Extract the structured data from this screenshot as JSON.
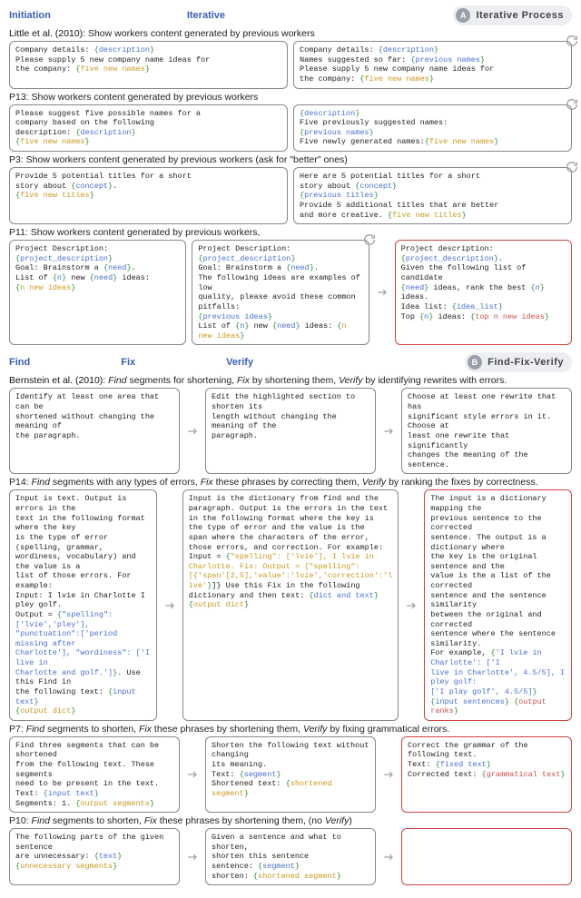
{
  "sectionA": {
    "badge": {
      "letter": "A",
      "label": "Iterative Process"
    },
    "stages": {
      "left": "Initiation",
      "right": "Iterative"
    },
    "source": {
      "cite": "Little et al. (2010): ",
      "desc": "Show workers content generated by previous workers"
    },
    "src_left": "Company details: {description}\nPlease supply 5 new company name ideas for\nthe company: {five new names}",
    "src_right": "Company details: {description}\nNames suggested so far: {previous names}\nPlease supply 5 new company name ideas for\nthe company: {five new names}",
    "p13": {
      "title": "P13: Show workers content generated by previous workers",
      "left": "Please suggest five possible names for a\ncompany based on the following\ndescription: {description}\n{five new names}",
      "right": "{description}\nFive previously suggested names:\n{previous names}\nFive newly generated names:{five new names}"
    },
    "p3": {
      "title": "P3: Show workers content generated by previous workers (ask for \"better\" ones)",
      "left": "Provide 5 potential titles for a short\nstory about {concept}.\n{five new titles}",
      "right": "Here are 5 potential titles for a short\nstory about {concept}\n{previous titles}\nProvide 5 additional titles that are better\nand more creative. {five new titles}"
    },
    "p11": {
      "title": "P11: Show workers content generated by previous workers,",
      "left": "Project Description: {project_description}\nGoal: Brainstorm a {need}.\nList of {n} new {need} ideas:\n{n new ideas}",
      "mid": "Project Description: {project_description}\nGoal: Brainstorm a {need}.\nThe following ideas are examples of low\nquality, please avoid these common pitfalls:\n{previous ideas}\nList of {n} new {need} ideas: {n new ideas}",
      "right": "Project description:{project_description}.\nGiven the following list of candidate\n{need} ideas, rank the best {n} ideas.\nIdea list: {idea_list}\nTop {n} ideas: {top n new ideas}"
    }
  },
  "sectionB": {
    "badge": {
      "letter": "B",
      "label": "Find-Fix-Verify"
    },
    "stages": {
      "a": "Find",
      "b": "Fix",
      "c": "Verify"
    },
    "source": {
      "cite": "Bernstein et al. (2010): ",
      "desc_a": "Find",
      "desc_a2": " segments for shortening, ",
      "desc_b": "Fix",
      "desc_b2": " by shortening them, ",
      "desc_c": "Verify",
      "desc_c2": " by identifying rewrites with errors."
    },
    "src_a": "Identify at least one area that can be\nshortened without changing the meaning of\nthe paragraph.",
    "src_b": "Edit the highlighted section to shorten its\nlength without changing the meaning of the\nparagraph.",
    "src_c": "Choose at least one rewrite that has\nsignificant style errors in it. Choose at\nleast one rewrite that significantly\nchanges the meaning of the sentence.",
    "p14": {
      "title": "P14: Find segments with any types of errors, Fix these phrases by correcting them, Verify by ranking the fixes by correctness.",
      "a": "Input is text. Output is errors in the\ntext in the following format where the key\nis the type of error (spelling, grammar,\nwordiness, vocabulary) and the value is a\nlist of those errors. For example:\nInput: I lvie in Charlotte I pley golf.\nOutput = {\"spelling\":['lvie','pley'],\n\"punctuation\":['period missing after\nCharlotte'], \"wordiness\": ['I live in\nCharlotte and golf.']}. Use this Find in\nthe following text: {input text}\n{output dict}",
      "b": "Input is the dictionary from find and the\nparagraph. Output is the errors in the text\nin the following format where the key is\nthe type of error and the value is the\nspan where the characters of the error,\nthose errors, and correction. For example:\nInput = {\"spelling\": ['lvie'], I lvie in\nCharlotte. Fix: Output = {\"spelling\":\n[{'span'[2,5],'value':'lvie','correction':'l\nive'}]} Use this Fix in the following\ndictionary and then text: {dict and text}\n{output dict}",
      "c": "The input is a dictionary mapping the\nprevious sentence to the corrected\nsentence. The output is a dictionary where\nthe key is the original sentence and the\nvalue is the a list of the corrected\nsentence and the sentence similarity\nbetween the original and corrected\nsentence where the sentence similarity.\nFor example, {'I lvie in Charlotte': ['I\nlive in Charlotte', 4.5/5], I pley golf:\n['I play golf', 4.5/5]}\n{input sentences} {output ranks}"
    },
    "p7": {
      "title": "P7: Find segments to shorten, Fix these phrases by shortening them, Verify by fixing grammatical errors.",
      "a": "Find three segments that can be shortened\nfrom the following text. These segments\nneed to be present in the text.\nText: {input text}\nSegments: 1. {output segments}",
      "b": "Shorten the following text without changing\nits meaning.\nText: {segment}\nShortened text: {shortened segment}",
      "c": "Correct the grammar of the following text.\nText: {fixed text}\nCorrected text: {grammatical text}"
    },
    "p10": {
      "title": "P10: Find segments to shorten, Fix these phrases by shortening them, (no Verify)",
      "a": "The following parts of the given sentence\nare unnecessary: {text}\n{unnecessary segments}",
      "b": "Given a sentence and what to shorten,\nshorten this sentence\nsentence: {segment}\nshorten: {shortened segment}",
      "c": ""
    }
  }
}
